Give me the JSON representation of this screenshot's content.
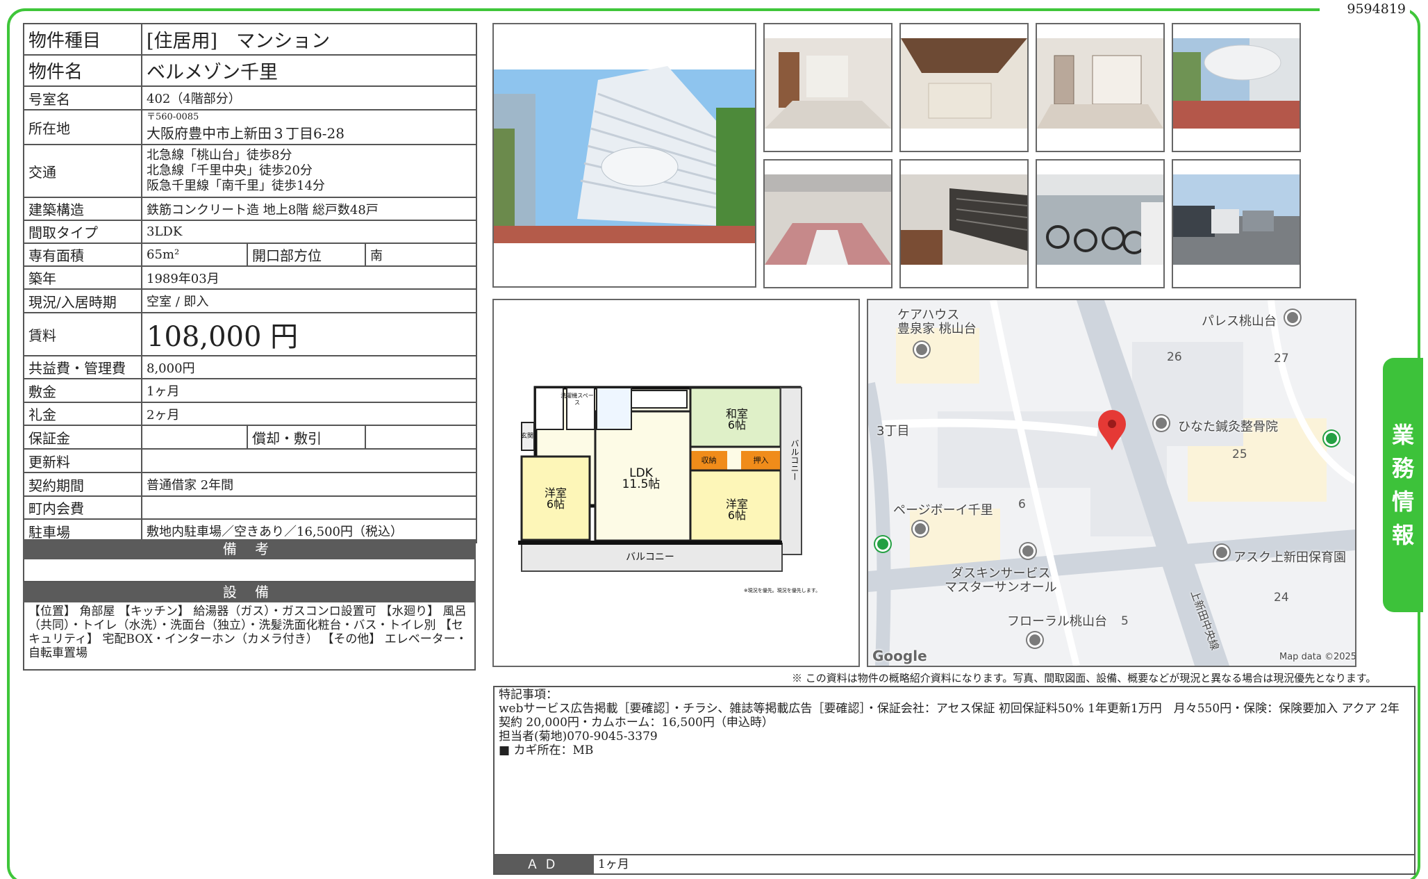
{
  "doc_id": "9594819",
  "side_tab": [
    "業",
    "務",
    "情",
    "報"
  ],
  "property": {
    "type_label": "物件種目",
    "type_value": "[住居用]　マンション",
    "name_label": "物件名",
    "name_value": "ベルメゾン千里",
    "room_label": "号室名",
    "room_value": "402（4階部分）",
    "address_label": "所在地",
    "postal": "〒560-0085",
    "address_value": "大阪府豊中市上新田３丁目6-28",
    "access_label": "交通",
    "access": [
      "北急線「桃山台」徒歩8分",
      "北急線「千里中央」徒歩20分",
      "阪急千里線「南千里」徒歩14分"
    ],
    "structure_label": "建築構造",
    "structure_value": "鉄筋コンクリート造 地上8階 総戸数48戸",
    "layout_label": "間取タイプ",
    "layout_value": "3LDK",
    "area_label": "専有面積",
    "area_value": "65m²",
    "orientation_label": "開口部方位",
    "orientation_value": "南",
    "built_label": "築年",
    "built_value": "1989年03月",
    "status_label": "現況/入居時期",
    "status_value": "空室 / 即入",
    "rent_label": "賃料",
    "rent_value": "108,000 円",
    "fee_label": "共益費・管理費",
    "fee_value": "8,000円",
    "deposit_label": "敷金",
    "deposit_value": "1ヶ月",
    "keymoney_label": "礼金",
    "keymoney_value": "2ヶ月",
    "guarantee_label": "保証金",
    "guarantee_value": "",
    "amort_label": "償却・敷引",
    "amort_value": "",
    "renewal_label": "更新料",
    "renewal_value": "",
    "contract_label": "契約期間",
    "contract_value": "普通借家 2年間",
    "community_label": "町内会費",
    "community_value": "",
    "parking_label": "駐車場",
    "parking_value": "敷地内駐車場／空きあり／16,500円（税込）"
  },
  "memo_header": "備 考",
  "equipment_header": "設 備",
  "equipment_text": "【位置】 角部屋 【キッチン】 給湯器（ガス）・ガスコンロ設置可 【水廻り】 風呂（共同）・トイレ（水洗）・洗面台（独立）・洗髪洗面化粧台・バス・トイレ別 【セキュリティ】 宅配BOX・インターホン（カメラ付き） 【その他】 エレベーター・自転車置場",
  "floorplan": {
    "ldk": "LDK",
    "ldk_size": "11.5帖",
    "washitsu": "和室",
    "washitsu_size": "6帖",
    "yoshitsu_left": "洋室",
    "yoshitsu_left_size": "6帖",
    "yoshitsu_right": "洋室",
    "yoshitsu_right_size": "6帖",
    "storage1": "収納",
    "storage2": "押入",
    "balcony_bottom": "バルコニー",
    "balcony_side": "バルコニー",
    "entrance": "玄関",
    "washer": "洗濯機スペース",
    "note": "※現況を優先。現況を優先します。"
  },
  "map": {
    "labels": [
      "ケアハウス",
      "豊泉家 桃山台",
      "パレス桃山台",
      "ひなた鍼灸整骨院",
      "3丁目",
      "ページボーイ千里",
      "アスク上新田保育園",
      "ダスキンサービス",
      "マスターサンオール",
      "フローラル桃山台",
      "上新田中央線"
    ],
    "numbers": [
      "26",
      "27",
      "25",
      "6",
      "24",
      "5"
    ],
    "google": "Google",
    "mapdata": "Map data ©2025"
  },
  "notice": "※ この資料は物件の概略紹介資料になります。写真、間取図面、設備、概要などが現況と異なる場合は現況優先となります。",
  "remarks": {
    "title": "特記事項：",
    "line1": "webサービス広告掲載［要確認］・チラシ、雑誌等掲載広告［要確認］・保証会社：アセス保証 初回保証料50% 1年更新1万円　月々550円・保険：保険要加入 アクア 2年契約 20,000円・カムホーム：16,500円（申込時）",
    "line2": "担当者(菊地)070-9045-3379",
    "line3": "■ カギ所在：MB"
  },
  "ad_label": "ＡＤ",
  "ad_value": "1ヶ月"
}
